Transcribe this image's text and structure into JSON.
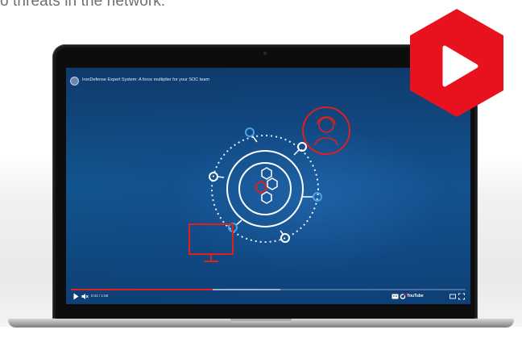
{
  "intro_text": "o threats in the network.",
  "video": {
    "title": "IronDefense Expert System: A force multiplier for your SOC team",
    "time": "0:41 / 1:56",
    "progress": 0.36,
    "buffered": 0.53,
    "youtube_label": "YouTube"
  },
  "colors": {
    "accent_red": "#e01f1f",
    "screen_blue": "#12558f",
    "badge_red": "#e8121e"
  },
  "icons": {
    "play": "play-icon",
    "volume": "volume-mute-icon",
    "captions": "captions-icon",
    "settings": "gear-icon",
    "theater": "theater-icon",
    "fullscreen": "fullscreen-icon",
    "badge": "youtube-play-badge"
  }
}
